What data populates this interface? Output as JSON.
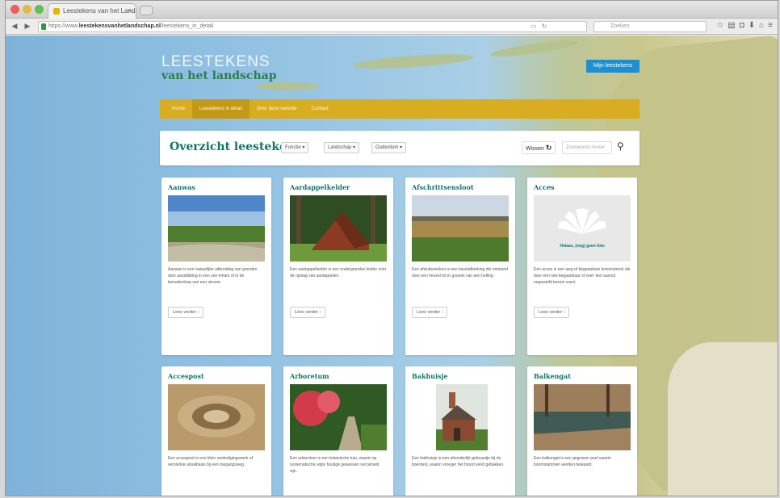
{
  "browser": {
    "tab_title": "Leestekens van het Landsch...",
    "url_prefix": "https://www.",
    "url_domain": "leestekensvanhetlandschap.nl",
    "url_path": "/leestekens_in_detail",
    "search_placeholder": "Zoeken"
  },
  "site": {
    "logo_line1": "LEESTEKENS",
    "logo_line2": "van het landschap",
    "top_button": "Mijn leestekens"
  },
  "nav": {
    "items": [
      "Home",
      "Leestekens in detail",
      "Over deze website",
      "Contact"
    ]
  },
  "overview": {
    "title": "Overzicht leestekens",
    "filters": [
      "Functie ▾",
      "Landschap ▾",
      "Ouderdom ▾"
    ],
    "reset_label": "Wissen",
    "search_placeholder": "Zoekwoord invoer"
  },
  "cards": [
    {
      "title": "Aanwas",
      "text": "Aanwas is een natuurlijke uitbreiding van gronden door aanslibbing in een zee-inham of in de benedenloop van een stroom.",
      "more": "Lees verder ›"
    },
    {
      "title": "Aardappelkelder",
      "text": "Een aardappelkelder is een ondergrondse kelder voor de opslag van aardappelen.",
      "more": "Lees verder ›"
    },
    {
      "title": "Afschrittsensloot",
      "text": "Een afsluitsensloot is een kavelafbreking die ontstond door een heuvel tot in gravels van een helling.",
      "more": "Lees verder ›"
    },
    {
      "title": "Acces",
      "text": "Een acces is een weg of begaanbare terreinstrook die door een niet-begaanbaar of veel- ken aanvul ongewiefd terrein voert.",
      "more": "Lees verder ›",
      "placeholder_text": "Helaas, (nog) geen foto"
    },
    {
      "title": "Accespost",
      "text": "Een accespost is een klein verdedigingswerk of versterkte uitvalbasis bij een toegangsweg.",
      "more": "Lees verder ›"
    },
    {
      "title": "Arboretum",
      "text": "Een arboretum is een botanische tuin, waarin op systematische wijze houtige gewassen verzameld zijn.",
      "more": "Lees verder ›"
    },
    {
      "title": "Bakhuisje",
      "text": "Een bakhuisje is een afzonderlijk gebouwtje bij de boerderij, waarin vroeger het brood werd gebakken.",
      "more": "Lees verder ›"
    },
    {
      "title": "Balkengat",
      "text": "Een balkengat is een gegraven poel waarin boomstammen werden bewaard.",
      "more": "Lees verder ›"
    }
  ],
  "colors": {
    "accent_teal": "#0f7567",
    "nav_gold": "#d8ad22",
    "button_blue": "#1c8fd0",
    "logo_green": "#2e7d4e"
  }
}
